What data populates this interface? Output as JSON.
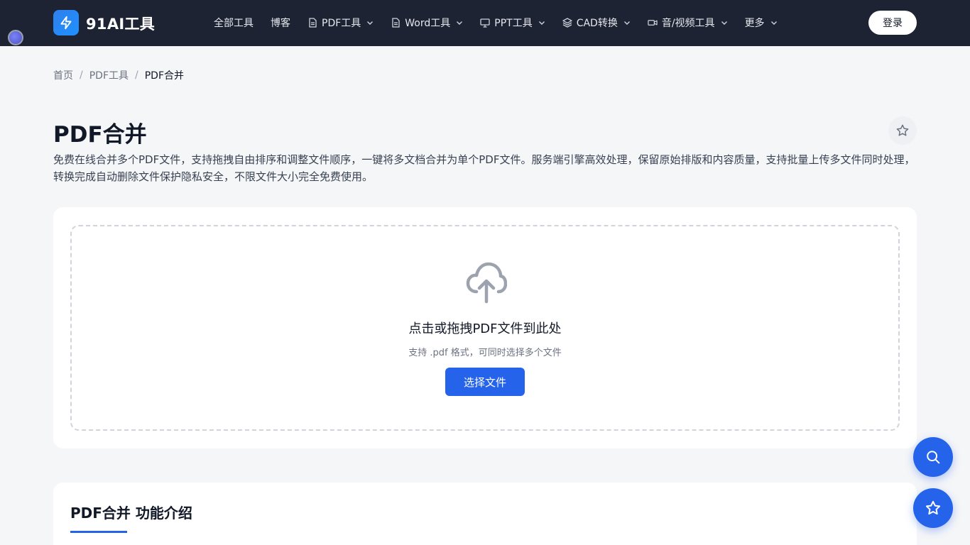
{
  "brand": {
    "name": "91AI工具",
    "icon": "lightning-icon"
  },
  "nav": {
    "items": [
      {
        "label": "全部工具",
        "icon": "",
        "has_dropdown": false
      },
      {
        "label": "博客",
        "icon": "",
        "has_dropdown": false
      },
      {
        "label": "PDF工具",
        "icon": "file-icon",
        "has_dropdown": true
      },
      {
        "label": "Word工具",
        "icon": "file-icon",
        "has_dropdown": true
      },
      {
        "label": "PPT工具",
        "icon": "presentation-icon",
        "has_dropdown": true
      },
      {
        "label": "CAD转换",
        "icon": "layers-icon",
        "has_dropdown": true
      },
      {
        "label": "音/视频工具",
        "icon": "video-icon",
        "has_dropdown": true
      },
      {
        "label": "更多",
        "icon": "",
        "has_dropdown": true
      }
    ],
    "login_label": "登录"
  },
  "breadcrumb": {
    "items": [
      "首页",
      "PDF工具",
      "PDF合并"
    ],
    "separator": "/"
  },
  "page": {
    "title": "PDF合并",
    "description": "免费在线合并多个PDF文件，支持拖拽自由排序和调整文件顺序，一键将多文档合并为单个PDF文件。服务端引擎高效处理，保留原始排版和内容质量，支持批量上传多文件同时处理，转换完成自动删除文件保护隐私安全，不限文件大小完全免费使用。"
  },
  "upload": {
    "title": "点击或拖拽PDF文件到此处",
    "subtitle": "支持 .pdf 格式，可同时选择多个文件",
    "button_label": "选择文件",
    "icon": "cloud-upload-icon"
  },
  "intro": {
    "title": "PDF合并 功能介绍"
  },
  "colors": {
    "topbar": "#1e2333",
    "accent": "#2563eb",
    "background": "#f5f6f8"
  }
}
